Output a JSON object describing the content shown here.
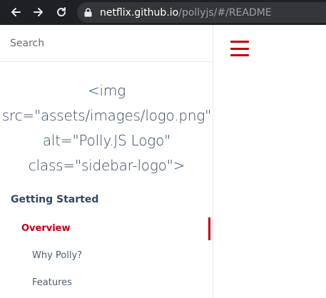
{
  "browser": {
    "url_host": "netflix.github.io",
    "url_path": "/pollyjs/#/README"
  },
  "sidebar": {
    "search_placeholder": "Search",
    "logo_text": "<img src=\"assets/images/logo.png\" alt=\"Polly.JS Logo\" class=\"sidebar-logo\">",
    "section_title": "Getting Started",
    "items": [
      {
        "label": "Overview",
        "active": true
      },
      {
        "label": "Why Polly?",
        "active": false
      },
      {
        "label": "Features",
        "active": false
      }
    ]
  },
  "colors": {
    "accent": "#c00012",
    "text": "#34495e",
    "browser_bg": "#1f2023"
  },
  "icons": {
    "back": "arrow-left-icon",
    "forward": "arrow-right-icon",
    "reload": "reload-icon",
    "lock": "lock-icon",
    "menu": "hamburger-menu-icon"
  }
}
